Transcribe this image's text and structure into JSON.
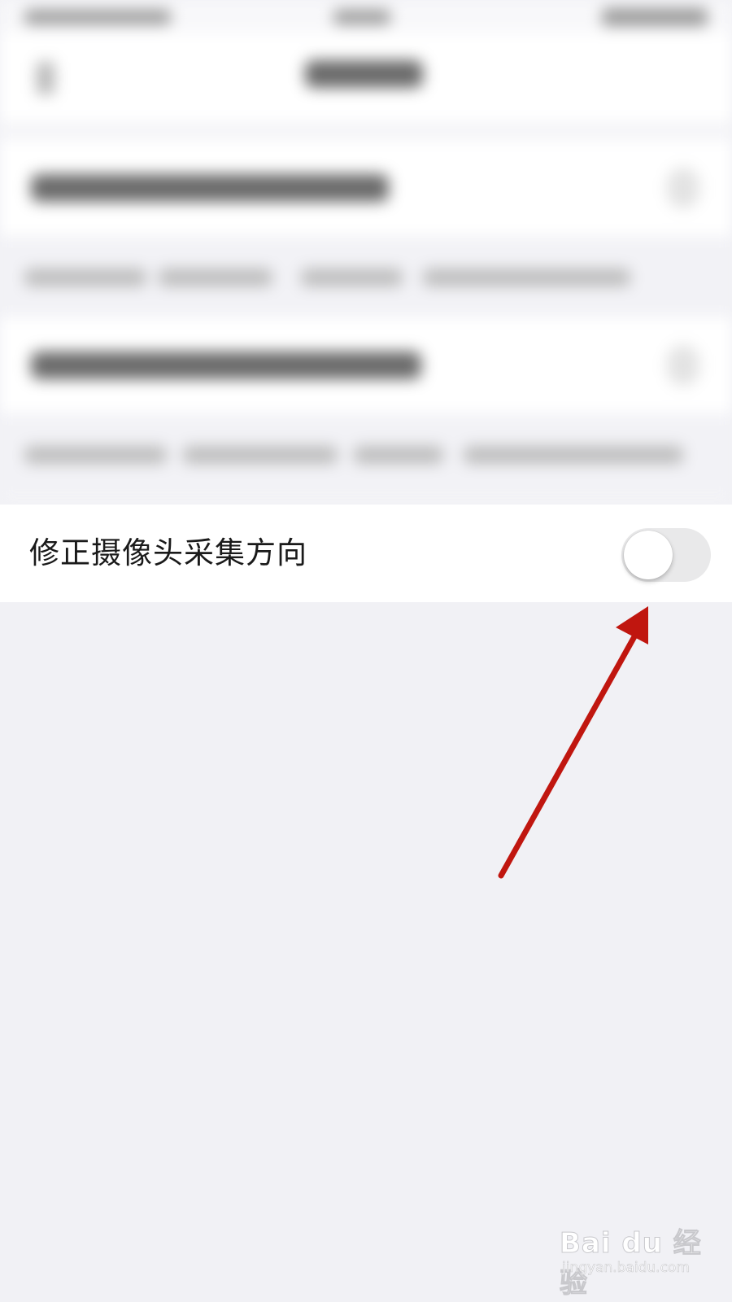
{
  "settings": {
    "camera_direction_label": "修正摄像头采集方向",
    "camera_direction_enabled": false
  },
  "colors": {
    "background": "#f1f1f5",
    "row_background": "#ffffff",
    "toggle_off_track": "#e9e9ea",
    "annotation_arrow": "#c0160f"
  },
  "watermark": {
    "brand": "Bai du 经验",
    "url": "jingyan.baidu.com"
  }
}
